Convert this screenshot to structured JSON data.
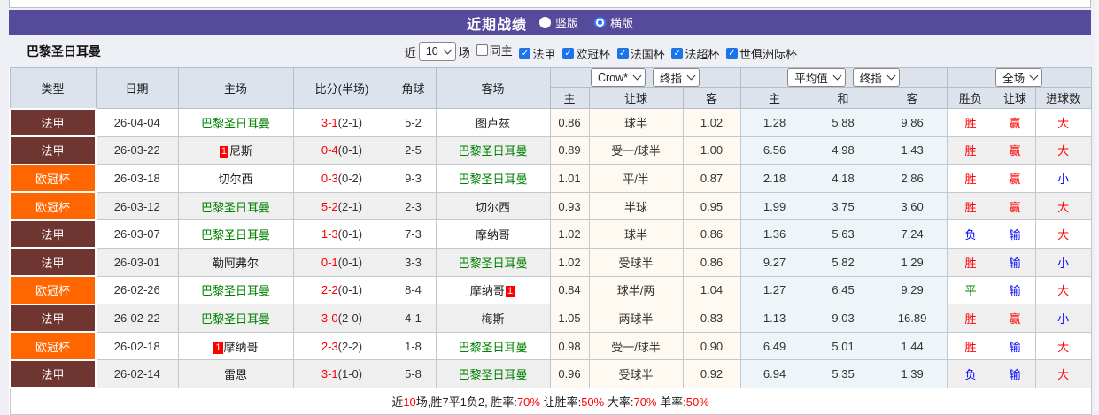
{
  "colors": {
    "accent_purple": "#564a9b",
    "league": {
      "法甲": "#6e3531",
      "欧冠杯": "#ff6600"
    },
    "result": {
      "胜": "#ff0000",
      "负": "#0000ff",
      "平": "#008000",
      "赢": "#ff0000",
      "输": "#0000ff",
      "大": "#ff0000",
      "小": "#0000ff"
    },
    "psg_green": "#008000",
    "score_red": "#ff0000",
    "card_red": "#ff0000",
    "checkbox_blue": "#1b74e8"
  },
  "titlebar": {
    "title": "近期战绩",
    "radio_vertical": "竖版",
    "radio_horizontal": "横版",
    "selected": "横版"
  },
  "filterbar": {
    "team": "巴黎圣日耳曼",
    "near_label": "近",
    "count_value": "10",
    "matches_label": "场",
    "checkboxes": [
      {
        "label": "同主",
        "checked": false
      },
      {
        "label": "法甲",
        "checked": true
      },
      {
        "label": "欧冠杯",
        "checked": true
      },
      {
        "label": "法国杯",
        "checked": true
      },
      {
        "label": "法超杯",
        "checked": true
      },
      {
        "label": "世俱洲际杯",
        "checked": true
      }
    ]
  },
  "table": {
    "selects": {
      "bookmaker": "Crow*",
      "bookmaker_time": "终指",
      "average": "平均值",
      "average_time": "终指",
      "scope": "全场"
    },
    "headers": {
      "type": "类型",
      "date": "日期",
      "home": "主场",
      "score": "比分(半场)",
      "corner": "角球",
      "away": "客场",
      "odds_home": "主",
      "odds_handicap": "让球",
      "odds_away": "客",
      "avg_home": "主",
      "avg_draw": "和",
      "avg_away": "客",
      "result_wl": "胜负",
      "result_handicap": "让球",
      "result_goals": "进球数"
    },
    "rows": [
      {
        "league": "法甲",
        "date": "26-04-04",
        "home": "巴黎圣日耳曼",
        "home_psg": true,
        "home_card": "",
        "home_card_pos": "",
        "score": "3-1",
        "half": "(2-1)",
        "corner": "5-2",
        "away": "图卢兹",
        "away_psg": false,
        "away_card": "",
        "away_card_pos": "",
        "odds": [
          "0.86",
          "球半",
          "1.02"
        ],
        "avg": [
          "1.28",
          "5.88",
          "9.86"
        ],
        "wl": "胜",
        "rh": "赢",
        "rg": "大"
      },
      {
        "league": "法甲",
        "date": "26-03-22",
        "home": "尼斯",
        "home_psg": false,
        "home_card": "1",
        "home_card_pos": "before",
        "score": "0-4",
        "half": "(0-1)",
        "corner": "2-5",
        "away": "巴黎圣日耳曼",
        "away_psg": true,
        "away_card": "",
        "away_card_pos": "",
        "odds": [
          "0.89",
          "受一/球半",
          "1.00"
        ],
        "avg": [
          "6.56",
          "4.98",
          "1.43"
        ],
        "wl": "胜",
        "rh": "赢",
        "rg": "大"
      },
      {
        "league": "欧冠杯",
        "date": "26-03-18",
        "home": "切尔西",
        "home_psg": false,
        "home_card": "",
        "home_card_pos": "",
        "score": "0-3",
        "half": "(0-2)",
        "corner": "9-3",
        "away": "巴黎圣日耳曼",
        "away_psg": true,
        "away_card": "",
        "away_card_pos": "",
        "odds": [
          "1.01",
          "平/半",
          "0.87"
        ],
        "avg": [
          "2.18",
          "4.18",
          "2.86"
        ],
        "wl": "胜",
        "rh": "赢",
        "rg": "小"
      },
      {
        "league": "欧冠杯",
        "date": "26-03-12",
        "home": "巴黎圣日耳曼",
        "home_psg": true,
        "home_card": "",
        "home_card_pos": "",
        "score": "5-2",
        "half": "(2-1)",
        "corner": "2-3",
        "away": "切尔西",
        "away_psg": false,
        "away_card": "",
        "away_card_pos": "",
        "odds": [
          "0.93",
          "半球",
          "0.95"
        ],
        "avg": [
          "1.99",
          "3.75",
          "3.60"
        ],
        "wl": "胜",
        "rh": "赢",
        "rg": "大"
      },
      {
        "league": "法甲",
        "date": "26-03-07",
        "home": "巴黎圣日耳曼",
        "home_psg": true,
        "home_card": "",
        "home_card_pos": "",
        "score": "1-3",
        "half": "(0-1)",
        "corner": "7-3",
        "away": "摩纳哥",
        "away_psg": false,
        "away_card": "",
        "away_card_pos": "",
        "odds": [
          "1.02",
          "球半",
          "0.86"
        ],
        "avg": [
          "1.36",
          "5.63",
          "7.24"
        ],
        "wl": "负",
        "rh": "输",
        "rg": "大"
      },
      {
        "league": "法甲",
        "date": "26-03-01",
        "home": "勒阿弗尔",
        "home_psg": false,
        "home_card": "",
        "home_card_pos": "",
        "score": "0-1",
        "half": "(0-1)",
        "corner": "3-3",
        "away": "巴黎圣日耳曼",
        "away_psg": true,
        "away_card": "",
        "away_card_pos": "",
        "odds": [
          "1.02",
          "受球半",
          "0.86"
        ],
        "avg": [
          "9.27",
          "5.82",
          "1.29"
        ],
        "wl": "胜",
        "rh": "输",
        "rg": "小"
      },
      {
        "league": "欧冠杯",
        "date": "26-02-26",
        "home": "巴黎圣日耳曼",
        "home_psg": true,
        "home_card": "",
        "home_card_pos": "",
        "score": "2-2",
        "half": "(0-1)",
        "corner": "8-4",
        "away": "摩纳哥",
        "away_psg": false,
        "away_card": "1",
        "away_card_pos": "after",
        "odds": [
          "0.84",
          "球半/两",
          "1.04"
        ],
        "avg": [
          "1.27",
          "6.45",
          "9.29"
        ],
        "wl": "平",
        "rh": "输",
        "rg": "大"
      },
      {
        "league": "法甲",
        "date": "26-02-22",
        "home": "巴黎圣日耳曼",
        "home_psg": true,
        "home_card": "",
        "home_card_pos": "",
        "score": "3-0",
        "half": "(2-0)",
        "corner": "4-1",
        "away": "梅斯",
        "away_psg": false,
        "away_card": "",
        "away_card_pos": "",
        "odds": [
          "1.05",
          "两球半",
          "0.83"
        ],
        "avg": [
          "1.13",
          "9.03",
          "16.89"
        ],
        "wl": "胜",
        "rh": "赢",
        "rg": "小"
      },
      {
        "league": "欧冠杯",
        "date": "26-02-18",
        "home": "摩纳哥",
        "home_psg": false,
        "home_card": "1",
        "home_card_pos": "before",
        "score": "2-3",
        "half": "(2-2)",
        "corner": "1-8",
        "away": "巴黎圣日耳曼",
        "away_psg": true,
        "away_card": "",
        "away_card_pos": "",
        "odds": [
          "0.98",
          "受一/球半",
          "0.90"
        ],
        "avg": [
          "6.49",
          "5.01",
          "1.44"
        ],
        "wl": "胜",
        "rh": "输",
        "rg": "大"
      },
      {
        "league": "法甲",
        "date": "26-02-14",
        "home": "雷恩",
        "home_psg": false,
        "home_card": "",
        "home_card_pos": "",
        "score": "3-1",
        "half": "(1-0)",
        "corner": "5-8",
        "away": "巴黎圣日耳曼",
        "away_psg": true,
        "away_card": "",
        "away_card_pos": "",
        "odds": [
          "0.96",
          "受球半",
          "0.92"
        ],
        "avg": [
          "6.94",
          "5.35",
          "1.39"
        ],
        "wl": "负",
        "rh": "输",
        "rg": "大"
      }
    ]
  },
  "footer": {
    "segments": [
      {
        "text": "近",
        "red": false
      },
      {
        "text": "10",
        "red": true
      },
      {
        "text": "场,胜7平1负2, 胜率:",
        "red": false
      },
      {
        "text": "70%",
        "red": true
      },
      {
        "text": " 让胜率:",
        "red": false
      },
      {
        "text": "50%",
        "red": true
      },
      {
        "text": " 大率:",
        "red": false
      },
      {
        "text": "70%",
        "red": true
      },
      {
        "text": " 单率:",
        "red": false
      },
      {
        "text": "50%",
        "red": true
      }
    ]
  }
}
